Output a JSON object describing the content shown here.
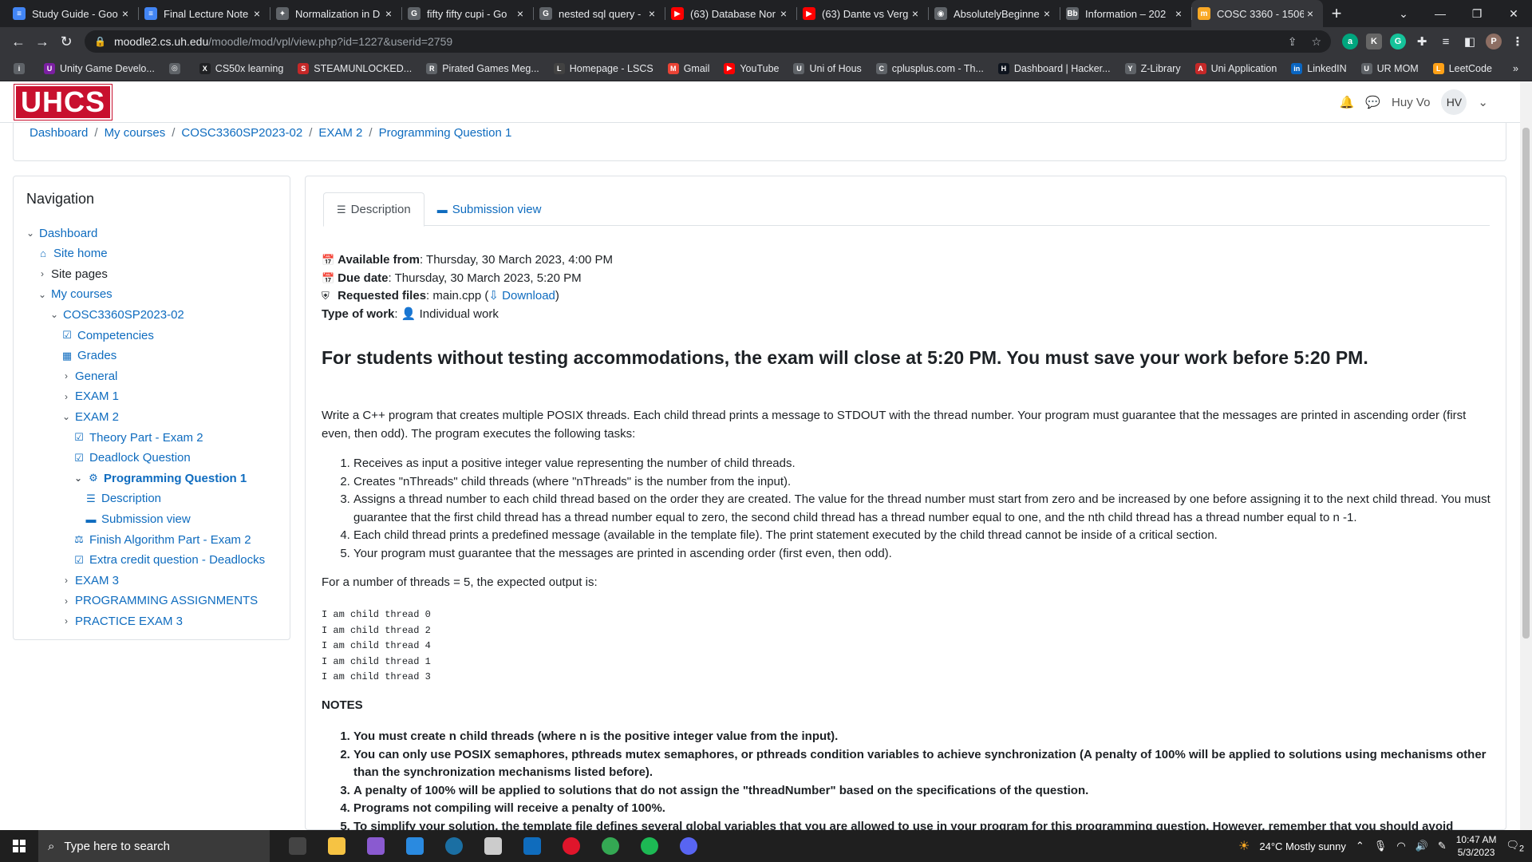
{
  "browser": {
    "tabs": [
      {
        "title": "Study Guide - Goo",
        "color": "#4285f4",
        "glyph": "≡"
      },
      {
        "title": "Final Lecture Note",
        "color": "#4285f4",
        "glyph": "≡"
      },
      {
        "title": "Normalization in D",
        "color": "#5f6368",
        "glyph": "✦"
      },
      {
        "title": "fifty fifty cupi - Go",
        "color": "#5f6368",
        "glyph": "G"
      },
      {
        "title": "nested sql query -",
        "color": "#5f6368",
        "glyph": "G"
      },
      {
        "title": "(63) Database Nor",
        "color": "#ff0000",
        "glyph": "▶"
      },
      {
        "title": "(63) Dante vs Verg",
        "color": "#ff0000",
        "glyph": "▶"
      },
      {
        "title": "AbsolutelyBeginne",
        "color": "#5f6368",
        "glyph": "◉"
      },
      {
        "title": "Information – 202",
        "color": "#5f6368",
        "glyph": "Bb"
      },
      {
        "title": "COSC 3360 - 1506",
        "color": "#f9a825",
        "glyph": "m"
      }
    ],
    "active_tab": 9,
    "url_host": "moodle2.cs.uh.edu",
    "url_path": "/moodle/mod/vpl/view.php?id=1227&userid=2759",
    "bookmarks": [
      {
        "label": "",
        "color": "#5f6368",
        "glyph": "i"
      },
      {
        "label": "Unity Game Develo...",
        "color": "#7b1fa2",
        "glyph": "U"
      },
      {
        "label": "",
        "color": "#5f6368",
        "glyph": "◎"
      },
      {
        "label": "CS50x learning",
        "color": "#202124",
        "glyph": "X"
      },
      {
        "label": "STEAMUNLOCKED...",
        "color": "#c62828",
        "glyph": "S"
      },
      {
        "label": "Pirated Games Meg...",
        "color": "#5f6368",
        "glyph": "R"
      },
      {
        "label": "Homepage - LSCS",
        "color": "#424242",
        "glyph": "L"
      },
      {
        "label": "Gmail",
        "color": "#ea4335",
        "glyph": "M"
      },
      {
        "label": "YouTube",
        "color": "#ff0000",
        "glyph": "▶"
      },
      {
        "label": "Uni of Hous",
        "color": "#5f6368",
        "glyph": "U"
      },
      {
        "label": "cplusplus.com - Th...",
        "color": "#5f6368",
        "glyph": "C"
      },
      {
        "label": "Dashboard | Hacker...",
        "color": "#0e141e",
        "glyph": "H"
      },
      {
        "label": "Z-Library",
        "color": "#5f6368",
        "glyph": "Y"
      },
      {
        "label": "Uni Application",
        "color": "#c62828",
        "glyph": "A"
      },
      {
        "label": "LinkedIN",
        "color": "#0a66c2",
        "glyph": "in"
      },
      {
        "label": "UR MOM",
        "color": "#5f6368",
        "glyph": "U"
      },
      {
        "label": "LeetCode",
        "color": "#ffa116",
        "glyph": "L"
      }
    ]
  },
  "header": {
    "logo": "UHCS",
    "user_name": "Huy Vo",
    "user_initials": "HV"
  },
  "breadcrumbs": [
    "Dashboard",
    "My courses",
    "COSC3360SP2023-02",
    "EXAM 2",
    "Programming Question 1"
  ],
  "navigation": {
    "title": "Navigation",
    "items": [
      {
        "label": "Dashboard",
        "chevron": "⌄",
        "icon": "",
        "indent": 0,
        "style": "link"
      },
      {
        "label": "Site home",
        "chevron": "",
        "icon": "⌂",
        "indent": 1,
        "style": "link"
      },
      {
        "label": "Site pages",
        "chevron": "›",
        "icon": "",
        "indent": 1,
        "style": "plain"
      },
      {
        "label": "My courses",
        "chevron": "⌄",
        "icon": "",
        "indent": 1,
        "style": "link"
      },
      {
        "label": "COSC3360SP2023-02",
        "chevron": "⌄",
        "icon": "",
        "indent": 2,
        "style": "link"
      },
      {
        "label": "Competencies",
        "chevron": "",
        "icon": "☑",
        "indent": 3,
        "style": "link"
      },
      {
        "label": "Grades",
        "chevron": "",
        "icon": "▦",
        "indent": 3,
        "style": "link"
      },
      {
        "label": "General",
        "chevron": "›",
        "icon": "",
        "indent": 3,
        "style": "link"
      },
      {
        "label": "EXAM 1",
        "chevron": "›",
        "icon": "",
        "indent": 3,
        "style": "link"
      },
      {
        "label": "EXAM 2",
        "chevron": "⌄",
        "icon": "",
        "indent": 3,
        "style": "link"
      },
      {
        "label": "Theory Part - Exam 2",
        "chevron": "",
        "icon": "☑",
        "indent": 4,
        "style": "link"
      },
      {
        "label": "Deadlock Question",
        "chevron": "",
        "icon": "☑",
        "indent": 4,
        "style": "link"
      },
      {
        "label": "Programming Question 1",
        "chevron": "⌄",
        "icon": "⚙",
        "indent": 4,
        "style": "bold"
      },
      {
        "label": "Description",
        "chevron": "",
        "icon": "☰",
        "indent": 5,
        "style": "link"
      },
      {
        "label": "Submission view",
        "chevron": "",
        "icon": "▬",
        "indent": 5,
        "style": "link"
      },
      {
        "label": "Finish Algorithm Part - Exam 2",
        "chevron": "",
        "icon": "⚖",
        "indent": 4,
        "style": "link"
      },
      {
        "label": "Extra credit question - Deadlocks",
        "chevron": "",
        "icon": "☑",
        "indent": 4,
        "style": "link"
      },
      {
        "label": "EXAM 3",
        "chevron": "›",
        "icon": "",
        "indent": 3,
        "style": "link"
      },
      {
        "label": "PROGRAMMING ASSIGNMENTS",
        "chevron": "›",
        "icon": "",
        "indent": 3,
        "style": "link"
      },
      {
        "label": "PRACTICE EXAM 3",
        "chevron": "›",
        "icon": "",
        "indent": 3,
        "style": "link"
      }
    ]
  },
  "content": {
    "tabs": [
      {
        "label": "Description",
        "icon": "☰"
      },
      {
        "label": "Submission view",
        "icon": "▬"
      }
    ],
    "available_label": "Available from",
    "available_value": ": Thursday, 30 March 2023, 4:00 PM",
    "due_label": "Due date",
    "due_value": ": Thursday, 30 March 2023, 5:20 PM",
    "files_label": "Requested files",
    "files_value": ": main.cpp (",
    "download_label": "Download",
    "files_close": ")",
    "work_label": "Type of work",
    "work_value": "Individual work",
    "headline": "For students without testing accommodations, the exam will close at 5:20 PM. You must save your work before 5:20 PM.",
    "intro": "Write a C++ program that creates multiple POSIX threads. Each child thread prints a message to STDOUT with the thread number. Your program must guarantee that the messages are printed in ascending order (first even, then odd). The program executes the following tasks:",
    "tasks": [
      "Receives as input a positive integer value representing the number of child threads.",
      "Creates \"nThreads\" child threads (where \"nThreads\" is the number from the input).",
      "Assigns a thread number to each child thread based on the order they are created. The value for the thread number must start from zero and be increased by one before assigning it to the next child thread. You must guarantee that the first child thread has a thread number equal to zero, the second child thread has a thread number equal to one, and the nth child thread has a thread number equal to n -1.",
      "Each child thread prints a predefined message (available in the template file). The print statement executed by the child thread cannot be inside of a critical section.",
      "Your program must guarantee that the messages are printed in ascending order (first even, then odd)."
    ],
    "expected_intro": "For a number of threads = 5, the expected output is:",
    "output_lines": [
      "I am child thread 0",
      "I am child thread 2",
      "I am child thread 4",
      "I am child thread 1",
      "I am child thread 3"
    ],
    "notes_title": "NOTES",
    "notes": [
      "You must create n child threads (where n is the positive integer value from the input).",
      "You can only use POSIX semaphores, pthreads mutex semaphores, or pthreads condition variables to achieve synchronization (A penalty of 100% will be applied to solutions using mechanisms other than the synchronization mechanisms listed before).",
      "A penalty of 100% will be applied to solutions that do not assign the \"threadNumber\" based on the specifications of the question.",
      "Programs not compiling will receive a penalty of 100%.",
      "To simplify your solution, the template file defines several global variables that you are allowed to use in your program for this programming question. However, remember that you should avoid using"
    ]
  },
  "taskbar": {
    "search_placeholder": "Type here to search",
    "weather": "24°C  Mostly sunny",
    "time": "10:47 AM",
    "date": "5/3/2023",
    "notifications": "2",
    "apps": [
      {
        "name": "task-view",
        "color": "#444"
      },
      {
        "name": "file-explorer",
        "color": "#f6c343"
      },
      {
        "name": "visual-studio",
        "color": "#8a5ad0"
      },
      {
        "name": "vs-code",
        "color": "#2a8ae0"
      },
      {
        "name": "steam",
        "color": "#1b6fa3"
      },
      {
        "name": "unity",
        "color": "#ccc"
      },
      {
        "name": "outlook",
        "color": "#0f6cbd"
      },
      {
        "name": "opera",
        "color": "#e0152b"
      },
      {
        "name": "chrome",
        "color": "#34a853"
      },
      {
        "name": "spotify",
        "color": "#1db954"
      },
      {
        "name": "discord",
        "color": "#5865f2"
      }
    ]
  }
}
